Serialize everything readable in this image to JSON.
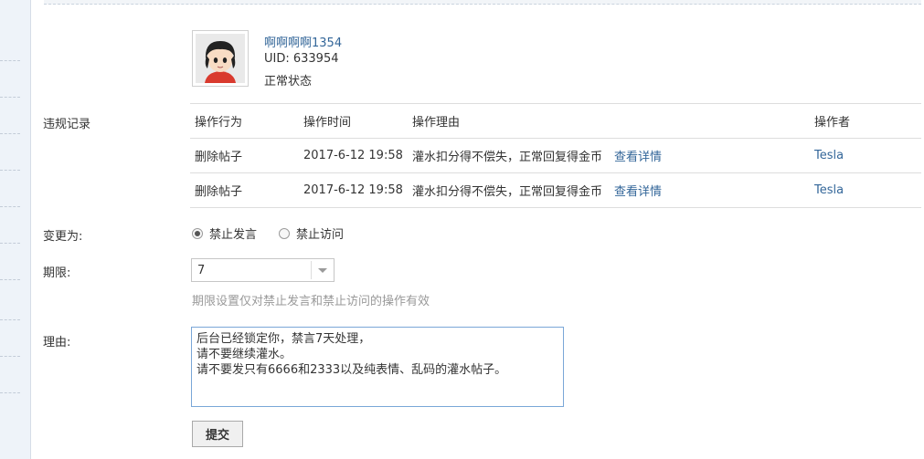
{
  "user": {
    "name": "啊啊啊啊1354",
    "uid": "UID: 633954",
    "status": "正常状态"
  },
  "labels": {
    "records": "违规记录",
    "change_to": "变更为:",
    "period": "期限:",
    "reason": "理由:"
  },
  "records_table": {
    "headers": [
      "操作行为",
      "操作时间",
      "操作理由",
      "操作者"
    ],
    "rows": [
      {
        "action": "删除帖子",
        "time": "2017-6-12 19:58",
        "reason": "灌水扣分得不偿失，正常回复得金币",
        "detail_link": "查看详情",
        "operator": "Tesla"
      },
      {
        "action": "删除帖子",
        "time": "2017-6-12 19:58",
        "reason": "灌水扣分得不偿失，正常回复得金币",
        "detail_link": "查看详情",
        "operator": "Tesla"
      }
    ]
  },
  "change_options": {
    "options": [
      "禁止发言",
      "禁止访问"
    ],
    "selected": "禁止发言"
  },
  "period": {
    "selected_value": "7",
    "hint": "期限设置仅对禁止发言和禁止访问的操作有效"
  },
  "reason_text": "后台已经锁定你，禁言7天处理，\n请不要继续灌水。\n请不要发只有6666和2333以及纯表情、乱码的灌水帖子。",
  "submit_label": "提交"
}
